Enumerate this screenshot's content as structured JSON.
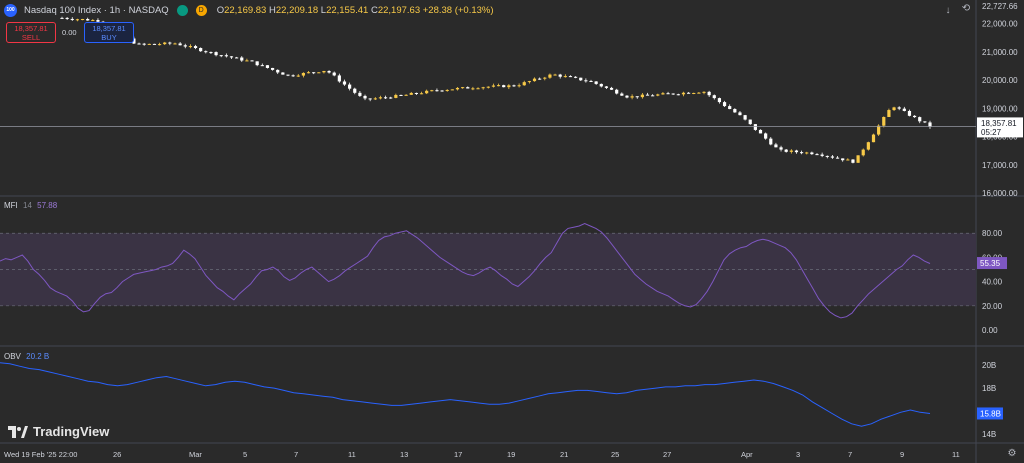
{
  "header": {
    "logo_text": "100",
    "title": "Nasdaq 100 Index · 1h · NASDAQ",
    "badge_d": "D",
    "open_label": "O",
    "open": "22,169.83",
    "high_label": "H",
    "high": "22,209.18",
    "low_label": "L",
    "low": "22,155.41",
    "close_label": "C",
    "close": "22,197.63",
    "change": "+28.38 (+0.13%)"
  },
  "trade": {
    "sell_price": "18,357.81",
    "sell_label": "SELL",
    "spread": "0.00",
    "buy_price": "18,357.81",
    "buy_label": "BUY"
  },
  "brand": {
    "name": "TradingView"
  },
  "top_right": {
    "top_price": "22,727.66"
  },
  "colors": {
    "background": "#2a2a2a",
    "candle_up": "#f7c948",
    "candle_down": "#ffffff",
    "mfi_line": "#7e57c2",
    "mfi_band": "#3a3344",
    "obv_line": "#2962ff",
    "last_price_bg": "#ffffff"
  },
  "chart_data": [
    {
      "type": "candlestick",
      "title": "Nasdaq 100 Index · 1h · NASDAQ",
      "ylim": [
        16000,
        22727.66
      ],
      "y_ticks": [
        "22,000.00",
        "21,000.00",
        "20,000.00",
        "19,000.00",
        "18,000.00",
        "17,000.00",
        "16,000.00"
      ],
      "last_price": "18,357.81",
      "countdown": "05:27",
      "approx_close_path": [
        {
          "x": "Feb 19",
          "close": 22200
        },
        {
          "x": "Feb 21",
          "close": 22100
        },
        {
          "x": "Feb 24",
          "close": 21250
        },
        {
          "x": "Feb 26",
          "close": 21300
        },
        {
          "x": "Feb 28",
          "close": 20950
        },
        {
          "x": "Mar 3",
          "close": 20650
        },
        {
          "x": "Mar 5",
          "close": 20150
        },
        {
          "x": "Mar 7",
          "close": 20350
        },
        {
          "x": "Mar 10",
          "close": 19300
        },
        {
          "x": "Mar 12",
          "close": 19450
        },
        {
          "x": "Mar 14",
          "close": 19650
        },
        {
          "x": "Mar 18",
          "close": 19750
        },
        {
          "x": "Mar 20",
          "close": 19800
        },
        {
          "x": "Mar 24",
          "close": 20200
        },
        {
          "x": "Mar 26",
          "close": 19950
        },
        {
          "x": "Mar 28",
          "close": 19400
        },
        {
          "x": "Apr 1",
          "close": 19500
        },
        {
          "x": "Apr 2",
          "close": 19600
        },
        {
          "x": "Apr 3",
          "close": 18700
        },
        {
          "x": "Apr 4",
          "close": 17500
        },
        {
          "x": "Apr 7",
          "close": 17400
        },
        {
          "x": "Apr 8",
          "close": 17100
        },
        {
          "x": "Apr 9",
          "close": 19100
        },
        {
          "x": "Apr 10",
          "close": 18357.81
        }
      ]
    },
    {
      "type": "line",
      "name": "MFI",
      "label": "MFI",
      "length": "14",
      "value": "57.88",
      "badge_value": "55.35",
      "ylim": [
        0,
        100
      ],
      "y_ticks": [
        "80.00",
        "60.00",
        "40.00",
        "20.00",
        "0.00"
      ],
      "bands": [
        20,
        50,
        80
      ],
      "values": [
        57,
        59,
        58,
        60,
        62,
        57,
        50,
        46,
        41,
        35,
        32,
        30,
        28,
        24,
        18,
        15,
        16,
        22,
        27,
        30,
        31,
        35,
        40,
        43,
        46,
        47,
        48,
        49,
        50,
        52,
        53,
        55,
        60,
        66,
        63,
        59,
        52,
        45,
        40,
        35,
        32,
        28,
        25,
        30,
        34,
        38,
        44,
        49,
        50,
        52,
        49,
        44,
        41,
        43,
        47,
        50,
        52,
        48,
        44,
        40,
        42,
        45,
        49,
        52,
        55,
        58,
        61,
        68,
        74,
        77,
        78,
        80,
        81,
        82,
        79,
        76,
        72,
        68,
        64,
        60,
        57,
        54,
        51,
        48,
        46,
        45,
        47,
        50,
        52,
        49,
        45,
        42,
        38,
        36,
        40,
        44,
        49,
        55,
        60,
        64,
        72,
        80,
        84,
        85,
        86,
        88,
        86,
        84,
        81,
        76,
        70,
        64,
        58,
        52,
        46,
        42,
        38,
        35,
        32,
        30,
        28,
        25,
        22,
        20,
        19,
        21,
        26,
        32,
        40,
        49,
        58,
        63,
        66,
        68,
        69,
        72,
        74,
        75,
        74,
        72,
        70,
        68,
        64,
        58,
        50,
        42,
        34,
        26,
        20,
        15,
        12,
        10,
        11,
        14,
        20,
        25,
        30,
        34,
        38,
        42,
        46,
        50,
        53,
        58,
        62,
        60,
        57,
        55
      ]
    },
    {
      "type": "line",
      "name": "OBV",
      "label": "OBV",
      "value": "20.2 B",
      "badge_value": "15.8B",
      "ylim": [
        13.5,
        21.3
      ],
      "y_ticks": [
        "20B",
        "18B",
        "16B",
        "14B"
      ],
      "values": [
        20.2,
        20.1,
        19.9,
        19.7,
        19.6,
        19.4,
        19.2,
        19.0,
        18.8,
        18.6,
        18.5,
        18.3,
        18.2,
        18.3,
        18.5,
        18.7,
        18.9,
        19.0,
        18.8,
        18.6,
        18.4,
        18.2,
        18.3,
        18.5,
        18.6,
        18.5,
        18.3,
        18.1,
        18.0,
        17.8,
        17.6,
        17.5,
        17.4,
        17.3,
        17.2,
        17.0,
        16.9,
        16.8,
        16.7,
        16.6,
        16.5,
        16.5,
        16.6,
        16.7,
        16.8,
        16.9,
        17.0,
        16.9,
        16.8,
        16.7,
        16.6,
        16.6,
        16.7,
        16.9,
        17.1,
        17.3,
        17.5,
        17.6,
        17.7,
        17.8,
        17.8,
        17.7,
        17.6,
        17.5,
        17.6,
        17.8,
        17.9,
        18.0,
        18.1,
        18.1,
        18.2,
        18.2,
        18.3,
        18.3,
        18.4,
        18.5,
        18.6,
        18.7,
        18.6,
        18.4,
        18.1,
        17.8,
        17.4,
        16.8,
        16.3,
        15.8,
        15.3,
        14.9,
        14.7,
        14.9,
        15.3,
        15.6,
        15.9,
        16.1,
        15.9,
        15.8
      ]
    }
  ],
  "x_axis": {
    "labels": [
      "Wed 19 Feb '25  22:00",
      "26",
      "Mar",
      "5",
      "7",
      "11",
      "13",
      "17",
      "19",
      "21",
      "25",
      "27",
      "Apr",
      "3",
      "7",
      "9",
      "11"
    ]
  }
}
